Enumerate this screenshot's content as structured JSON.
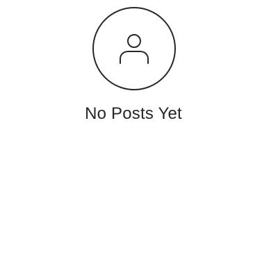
{
  "empty_state": {
    "icon": "person-icon",
    "title": "No Posts Yet"
  },
  "colors": {
    "icon_stroke": "#262626",
    "text": "#262626",
    "background": "#ffffff"
  }
}
